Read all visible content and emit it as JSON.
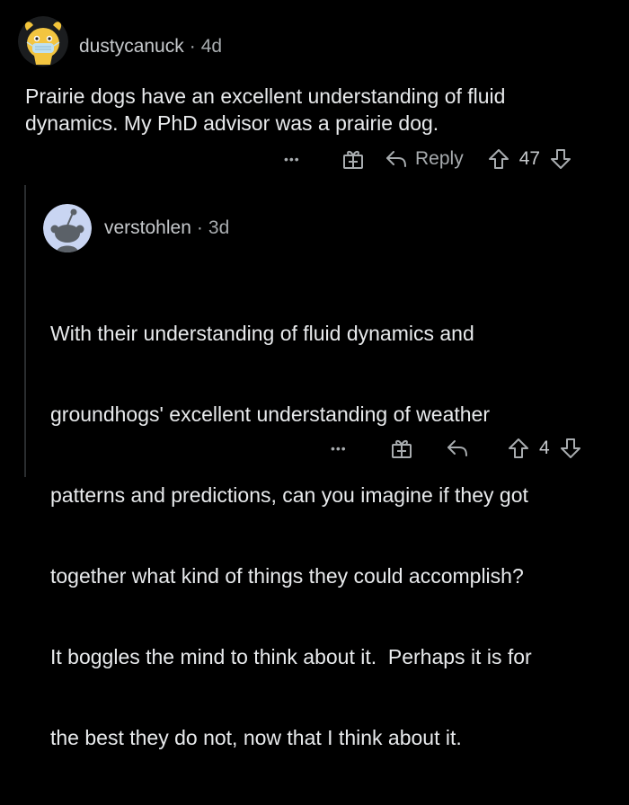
{
  "comments": [
    {
      "username": "dustycanuck",
      "separator": "·",
      "age": "4d",
      "body": [
        "Prairie dogs have an excellent understanding of fluid",
        "dynamics. My PhD advisor was a prairie dog."
      ],
      "more_label": "•••",
      "reply_label": "Reply",
      "vote_count": "47"
    },
    {
      "username": "verstohlen",
      "separator": "·",
      "age": "3d",
      "body": [
        "With their understanding of fluid dynamics and",
        "groundhogs' excellent understanding of weather",
        "patterns and predictions, can you imagine if they got",
        "together what kind of things they could accomplish?",
        "It boggles the mind to think about it.  Perhaps it is for",
        "the best they do not, now that I think about it."
      ],
      "more_label": "•••",
      "vote_count": "4"
    }
  ],
  "icons": {
    "gift": "gift-icon",
    "reply": "reply-arrow-icon",
    "upvote": "upvote-arrow-icon",
    "downvote": "downvote-arrow-icon"
  },
  "colors": {
    "background": "#000000",
    "text": "#e8eaec",
    "muted": "#a8acaf",
    "avatar_bg": "#c9d5f2"
  }
}
